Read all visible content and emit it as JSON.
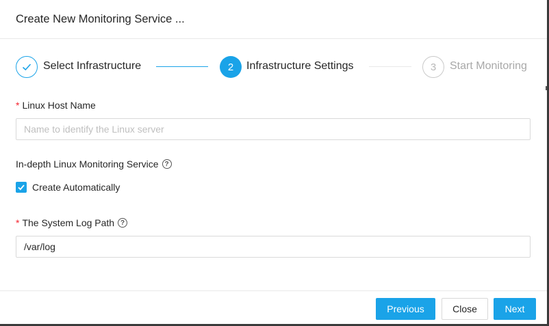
{
  "dialog": {
    "title": "Create New Monitoring Service ..."
  },
  "steps": [
    {
      "number": "1",
      "label": "Select Infrastructure",
      "status": "done"
    },
    {
      "number": "2",
      "label": "Infrastructure Settings",
      "status": "active"
    },
    {
      "number": "3",
      "label": "Start Monitoring",
      "status": "pending"
    }
  ],
  "form": {
    "host_name": {
      "required_mark": "*",
      "label": "Linux Host Name",
      "value": "",
      "placeholder": "Name to identify the Linux server"
    },
    "indepth": {
      "label": "In-depth Linux Monitoring Service",
      "help": "?",
      "checkbox_label": "Create Automatically",
      "checked": true
    },
    "log_path": {
      "required_mark": "*",
      "label": "The System Log Path",
      "help": "?",
      "value": "/var/log"
    }
  },
  "footer": {
    "previous_label": "Previous",
    "close_label": "Close",
    "next_label": "Next"
  },
  "colors": {
    "accent": "#1aa3e8",
    "required": "#f5222d"
  }
}
